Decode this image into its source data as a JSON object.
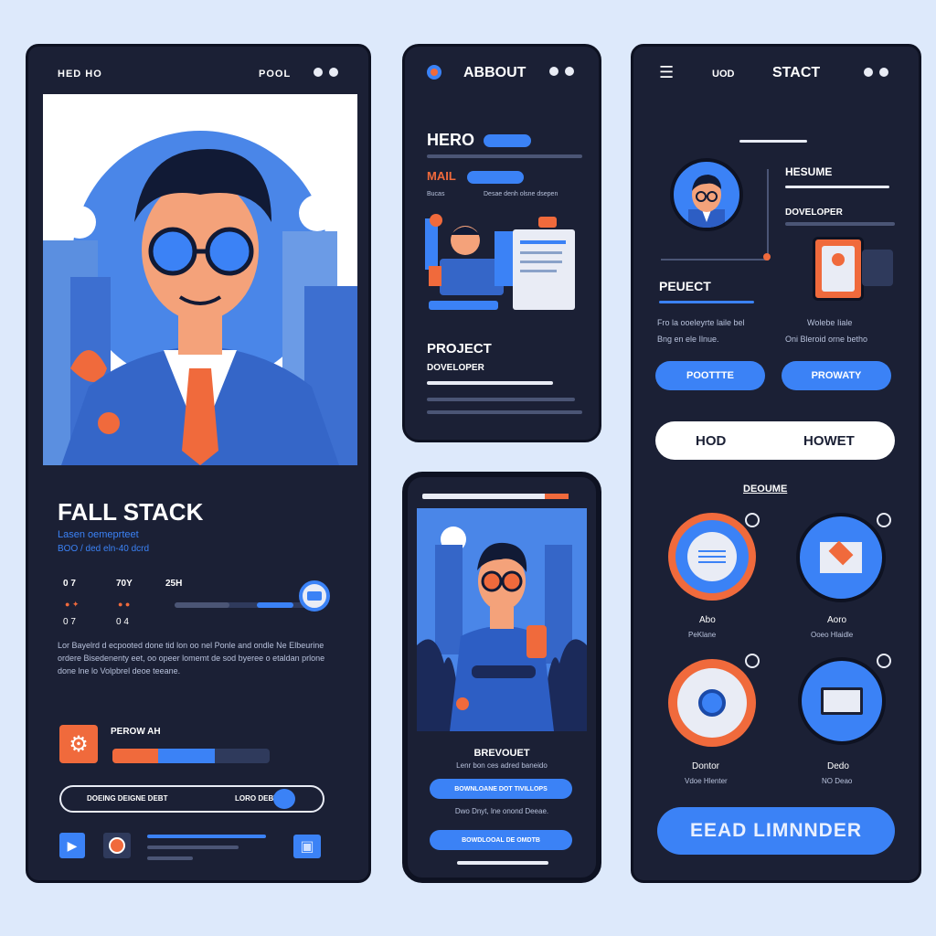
{
  "phone1": {
    "header_left": "HED HO",
    "header_right": "POOL",
    "title": "FALL STACK",
    "subtitle": "Lasen oemeprteet",
    "meta": "BOO / ded eln-40 dcrd",
    "stats": [
      {
        "label": "0 7",
        "sub": "0 7"
      },
      {
        "label": "70Y",
        "sub": "0 4"
      },
      {
        "label": "25H",
        "sub": ""
      }
    ],
    "paragraph": "Lor Bayelrd d ecpooted done tid lon oo nel Ponle and ondle Ne Elbeurine ordere Bisedenenty eet, oo opeer lomemt de sod byeree o etaldan prlone done lne lo Volpbrel deoe teeane.",
    "progress_label": "PEROW AH",
    "progress_value": 0.32,
    "search_left": "DOEING DEIGNE DEBT",
    "search_right": "LORO DEBT"
  },
  "phone2": {
    "title": "ABBOUT",
    "hero_label": "HERO",
    "mail_label": "MAIL",
    "mail_meta_left": "Bucas",
    "mail_meta_right": "Desae denh olsne dsepen",
    "project_title": "PROJECT",
    "project_sub": "DOVELOPER"
  },
  "phone3": {
    "caption": "BREVOUET",
    "caption_sub": "Lenr bon ces adred baneido",
    "btn1": "BOWNLOANE DOT TIVILLOPS",
    "note": "Dwo Dnyt, lne onond Deeae.",
    "btn2": "BOWDLOOAL DE OMDTB"
  },
  "phone4": {
    "header_mid": "UOD",
    "title": "STACT",
    "resume_label": "HESUME",
    "developer_label": "DOVELOPER",
    "project_label": "PEUECT",
    "desc_left_1": "Fro la ooeleyrte laile bel",
    "desc_left_2": "Bng en ele Ilnue.",
    "desc_right_1": "Wolebe Iiale",
    "desc_right_2": "Oni Bleroid orne betho",
    "btn_left": "POOTTTE",
    "btn_right": "PROWATY",
    "toggle_left": "HOD",
    "toggle_right": "HOWET",
    "section": "DEOUME",
    "tiles": [
      {
        "title": "Abo",
        "sub": "PeKlane"
      },
      {
        "title": "Aoro",
        "sub": "Ooeo Hlaidle"
      },
      {
        "title": "Dontor",
        "sub": "Vdoe Hlenter"
      },
      {
        "title": "Dedo",
        "sub": "NO Deao"
      }
    ],
    "cta": "EEAD LIMNNDER"
  },
  "colors": {
    "accent": "#3b82f6",
    "orange": "#f06a3c",
    "panel": "#1b2035",
    "background": "#dde9fb"
  }
}
